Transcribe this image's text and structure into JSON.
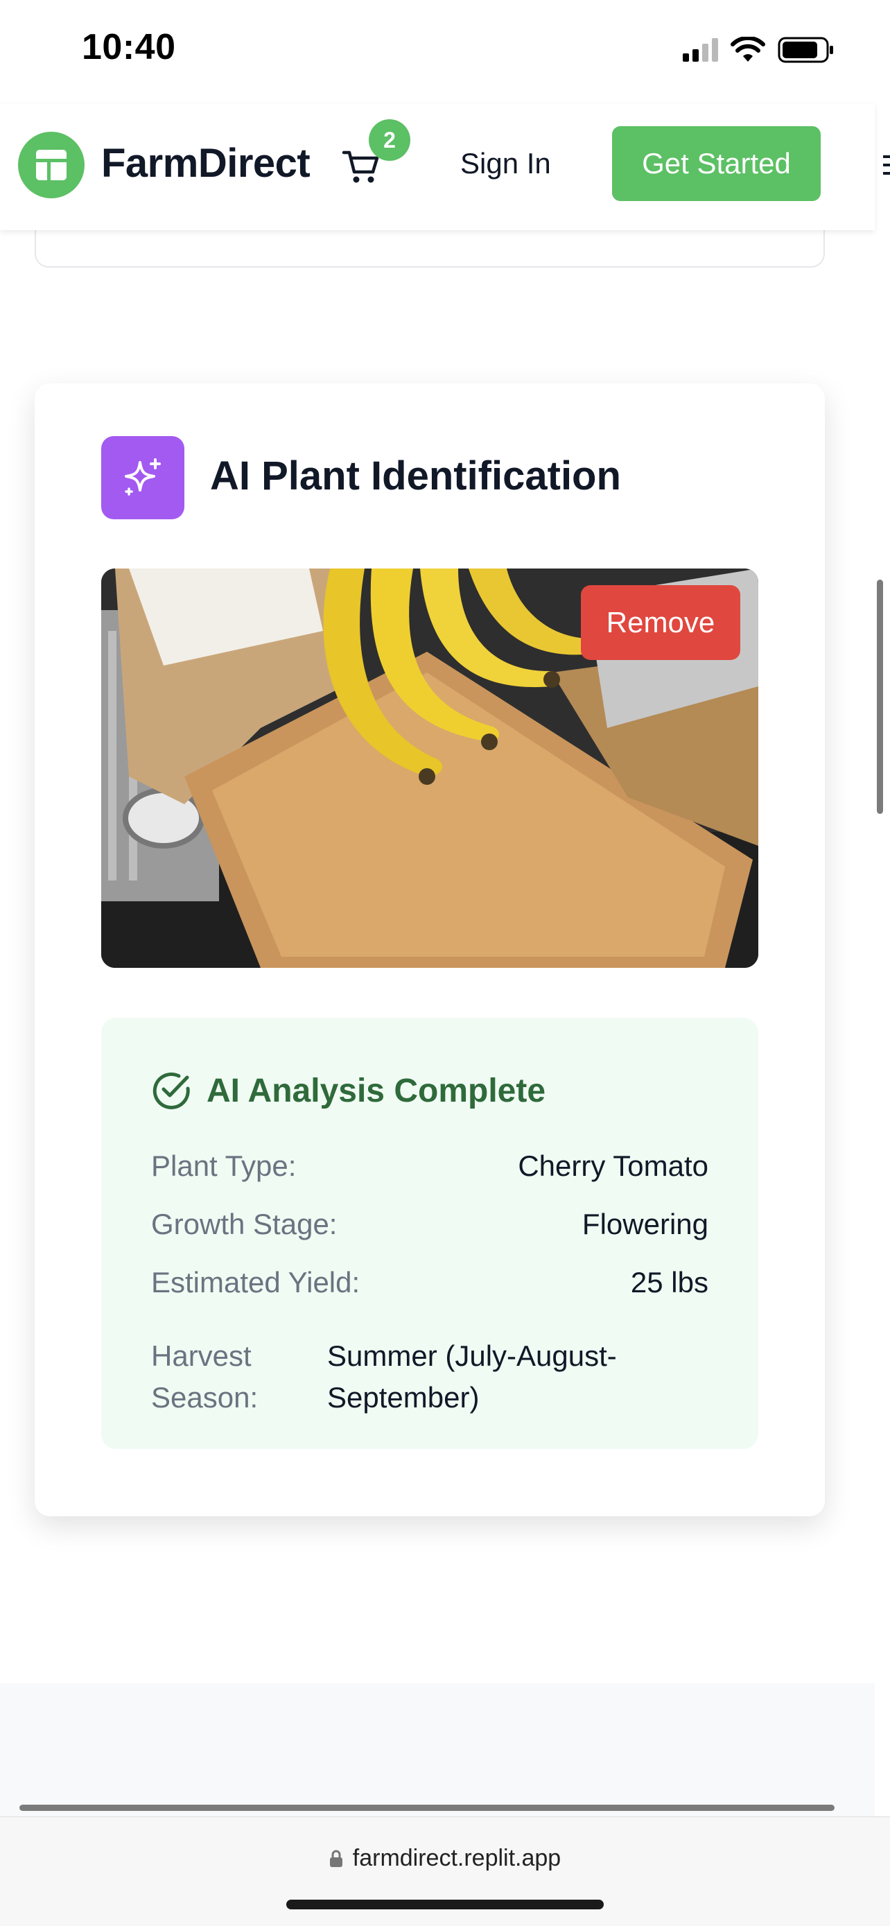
{
  "status_bar": {
    "time": "10:40",
    "icons": [
      "cellular-signal-icon",
      "wifi-icon",
      "battery-icon"
    ]
  },
  "nav": {
    "brand": "FarmDirect",
    "cart_count": "2",
    "sign_in": "Sign In",
    "get_started": "Get Started"
  },
  "ai_card": {
    "title": "AI Plant Identification",
    "remove_label": "Remove",
    "analysis": {
      "heading": "AI Analysis Complete",
      "rows": [
        {
          "label": "Plant Type:",
          "value": "Cherry Tomato"
        },
        {
          "label": "Growth Stage:",
          "value": "Flowering"
        },
        {
          "label": "Estimated Yield:",
          "value": "25 lbs"
        }
      ],
      "harvest": {
        "label": "Harvest Season:",
        "value": "Summer (July-August-September)"
      }
    }
  },
  "browser": {
    "url": "farmdirect.replit.app"
  },
  "colors": {
    "brand_green": "#5cc064",
    "ai_purple": "#a35af0",
    "remove_red": "#e0473f",
    "analysis_bg": "#f0fbf3",
    "analysis_title": "#2f6a3b"
  }
}
